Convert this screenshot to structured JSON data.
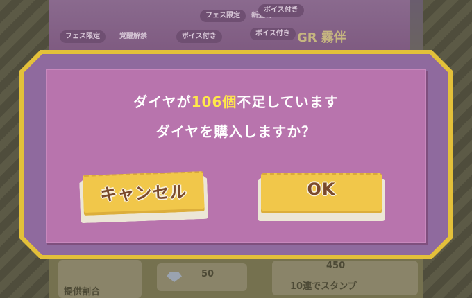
{
  "background": {
    "chips": [
      "フェス限定",
      "新登場",
      "フェス限定",
      "覚醒解禁",
      "ボイス付き",
      "ボイス付き",
      "ボイス付き"
    ],
    "gr_label": "GR",
    "gr_text": "霧伴",
    "price_left": "50",
    "price_right": "450",
    "stamp_text": "10連でスタンプ",
    "rate_text": "提供割合"
  },
  "dialog": {
    "line1_before": "ダイヤが",
    "line1_number": "106個",
    "line1_after": "不足しています",
    "line2": "ダイヤを購入しますか？",
    "cancel_label": "キャンセル",
    "ok_label": "OK"
  },
  "colors": {
    "frame": "#e3c03a",
    "panel": "#b874ad",
    "highlight": "#ffe84a",
    "button": "#f1c74a"
  }
}
